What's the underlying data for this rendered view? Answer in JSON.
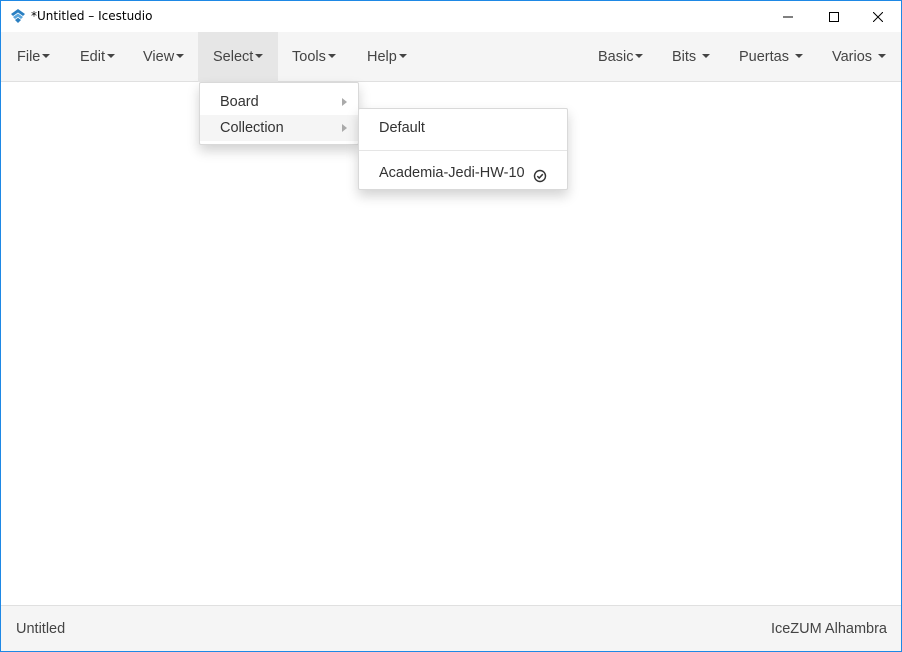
{
  "window": {
    "title": "*Untitled – Icestudio"
  },
  "menubar": {
    "left": [
      {
        "label": "File"
      },
      {
        "label": "Edit"
      },
      {
        "label": "View"
      },
      {
        "label": "Select"
      },
      {
        "label": "Tools"
      },
      {
        "label": "Help"
      }
    ],
    "right": [
      {
        "label": "Basic"
      },
      {
        "label": "Bits"
      },
      {
        "label": "Puertas"
      },
      {
        "label": "Varios"
      }
    ]
  },
  "select_menu": {
    "items": [
      {
        "label": "Board"
      },
      {
        "label": "Collection"
      }
    ]
  },
  "collection_menu": {
    "items": [
      {
        "label": "Default"
      },
      {
        "label": "Academia-Jedi-HW-10",
        "selected": true
      }
    ]
  },
  "status": {
    "left": "Untitled",
    "right": "IceZUM Alhambra"
  },
  "colors": {
    "window_border": "#1e88e5",
    "menubar_bg": "#f5f5f5",
    "active_menu_bg": "#e6e6e6"
  }
}
